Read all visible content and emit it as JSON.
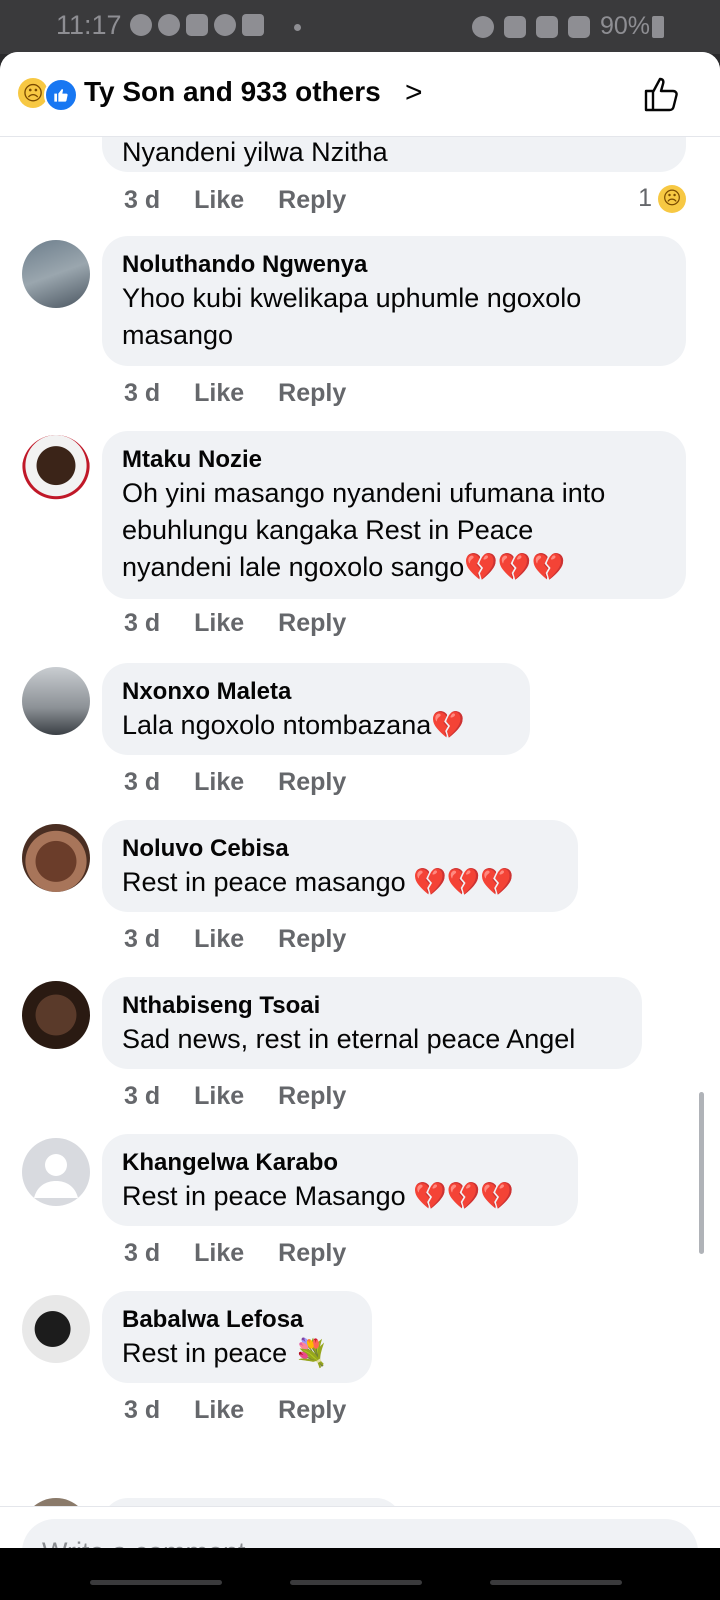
{
  "status_bar": {
    "time": "11:17",
    "battery": "90%"
  },
  "header": {
    "title": "Ty Son and 933 others"
  },
  "partial_comment": {
    "text": "Nyandeni yilwa Nzitha",
    "time": "3 d",
    "like": "Like",
    "reply": "Reply",
    "reaction_count": "1"
  },
  "comments": [
    {
      "name": "Noluthando Ngwenya",
      "line1": "Yhoo kubi  kwelikapa  uphumle ngoxolo",
      "line2": "masango",
      "line3": "",
      "time": "3 d",
      "like": "Like",
      "reply": "Reply"
    },
    {
      "name": "Mtaku Nozie",
      "line1": "Oh yini masango nyandeni ufumana into",
      "line2": "ebuhlungu kangaka Rest in Peace",
      "line3": "nyandeni lale ngoxolo sango💔💔💔",
      "time": "3 d",
      "like": "Like",
      "reply": "Reply"
    },
    {
      "name": "Nxonxo Maleta",
      "line1": "Lala ngoxolo ntombazana💔",
      "time": "3 d",
      "like": "Like",
      "reply": "Reply"
    },
    {
      "name": "Noluvo Cebisa",
      "line1": "Rest in peace masango 💔💔💔",
      "time": "3 d",
      "like": "Like",
      "reply": "Reply"
    },
    {
      "name": "Nthabiseng Tsoai",
      "line1": "Sad news, rest in eternal peace Angel",
      "time": "3 d",
      "like": "Like",
      "reply": "Reply"
    },
    {
      "name": "Khangelwa Karabo",
      "line1": "Rest in peace Masango 💔💔💔",
      "time": "3 d",
      "like": "Like",
      "reply": "Reply"
    },
    {
      "name": "Babalwa Lefosa",
      "line1": "Rest in peace 💐",
      "time": "3 d",
      "like": "Like",
      "reply": "Reply"
    }
  ],
  "composer": {
    "placeholder": "Write a comment…"
  },
  "colors": {
    "accent": "#1877f2",
    "bubble": "#f0f2f5",
    "meta": "#65676b",
    "heart": "#e41e3f"
  }
}
